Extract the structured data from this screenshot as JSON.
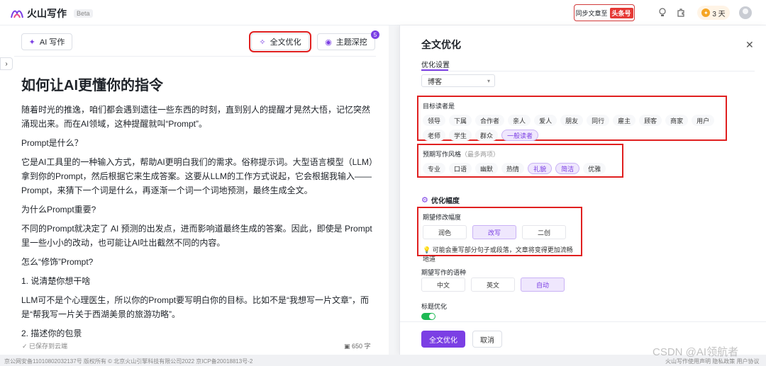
{
  "app": {
    "name": "火山写作",
    "beta": "Beta"
  },
  "topbar": {
    "sync_prefix": "同步文章至",
    "sync_target": "头条号",
    "streak": "3 天"
  },
  "toolbar": {
    "ai_write": "AI 写作",
    "full_optimize": "全文优化",
    "topic_deep": "主题深挖",
    "topic_badge": "5"
  },
  "document": {
    "title": "如何让AI更懂你的指令",
    "paragraphs": [
      "随着时光的推逸，咱们都会遇到遗往一些东西的时刻，直到别人的提醒才晃然大悟，记忆突然涌现出来。而在AI领域，这种提醒就叫“Prompt”。",
      "Prompt是什么？",
      "它是AI工具里的一种输入方式，帮助AI更明白我们的需求。俗称提示词。大型语言模型（LLM）拿到你的Prompt，然后根据它来生成答案。这要从LLM的工作方式说起，它会根据我输入——Prompt，来猜下一个词是什么，再逐渐一个词一个词地预测，最终生成全文。",
      "为什么Prompt重要?",
      "不同的Prompt就决定了 AI 预测的出发点，进而影响道最终生成的答案。因此，即使是 Prompt 里一些小小的改动，也可能让AI吐出截然不同的内容。",
      "怎么“修饰”Prompt?",
      "1. 说清楚你想干啥",
      "LLM可不是个心理医生，所以你的Prompt要写明白你的目标。比如不是“我想写一片文章”，而是“帮我写一片关于西湖美景的旅游功略”。",
      "2. 描述你的包景"
    ]
  },
  "status": {
    "saved": "已保存到云端",
    "word_count": "650 字"
  },
  "footer": {
    "left": "京公网安备11010802032137号    版权所有 © 北京火山引擎科技有限公司2022    京ICP备20018813号-2",
    "right": "火山写作使用声明  隐私政策  用户协议"
  },
  "drawer": {
    "title": "全文优化",
    "tab": "优化设置",
    "genre_value": "博客",
    "audience": {
      "label": "目标读者是",
      "options": [
        "领导",
        "下属",
        "合作者",
        "亲人",
        "爱人",
        "朋友",
        "同行",
        "雇主",
        "顾客",
        "商家",
        "用户",
        "老师",
        "学生",
        "群众",
        "一般读者"
      ],
      "selected": [
        "一般读者"
      ]
    },
    "style": {
      "label": "预期写作风格",
      "hint": "（最多两项）",
      "options": [
        "专业",
        "口语",
        "幽默",
        "热情",
        "礼貌",
        "简洁",
        "优雅"
      ],
      "selected": [
        "礼貌",
        "简洁"
      ]
    },
    "degree_title": "优化幅度",
    "degree": {
      "label": "期望修改幅度",
      "options": [
        "润色",
        "改写",
        "二创"
      ],
      "selected": "改写",
      "tip": "可能会重写部分句子或段落，文章将变得更加流畅地道"
    },
    "language": {
      "label": "期望写作的语种",
      "options": [
        "中文",
        "英文",
        "自动"
      ],
      "selected": "自动"
    },
    "title_opt_label": "标题优化",
    "title_opt_on": true,
    "confirm": "全文优化",
    "cancel": "取消"
  },
  "watermark": "CSDN @AI领航者",
  "colors": {
    "accent": "#7b3fe4",
    "highlight_box": "#e02020",
    "toggle_on": "#1db954"
  }
}
